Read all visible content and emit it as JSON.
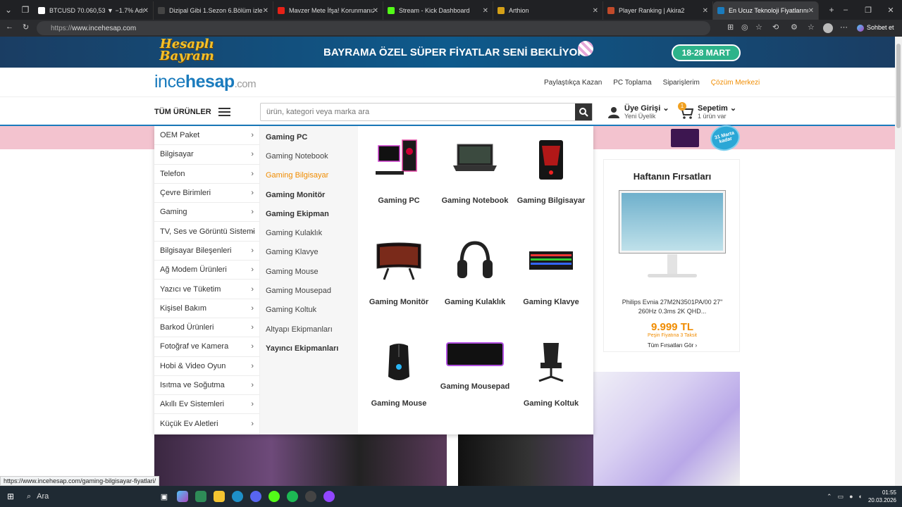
{
  "browser": {
    "tabs": [
      {
        "title": "BTCUSD 70.060,53 ▼ −1.7% Adsı",
        "color": "#ffffff"
      },
      {
        "title": "Dizipal Gibi 1.Sezon 6.Bölüm izle",
        "color": "#444444"
      },
      {
        "title": "Mavzer Mete İfşa! Korunmanız La",
        "color": "#e62117"
      },
      {
        "title": "Stream - Kick Dashboard",
        "color": "#53fc18"
      },
      {
        "title": "Arthion",
        "color": "#d4a017"
      },
      {
        "title": "Player Ranking | Akira2",
        "color": "#c14a2a"
      },
      {
        "title": "En Ucuz Teknoloji Fiyatlarını araya",
        "color": "#1a7bbd"
      }
    ],
    "url_protocol": "https://",
    "url_host": "www.incehesap.com",
    "copilot_label": "Sohbet et",
    "status_url": "https://www.incehesap.com/gaming-bilgisayar-fiyatlari/"
  },
  "banner": {
    "logo_text_1": "Hesaplı",
    "logo_text_2": "Bayram",
    "text": "BAYRAMA ÖZEL SÜPER FİYATLAR SENİ BEKLİYOR!",
    "date": "18-28 MART",
    "promo_text": "31 Marta kadar"
  },
  "header": {
    "logo_ince": "ince",
    "logo_hesap": "hesap",
    "logo_com": ".com",
    "links": [
      "Paylaştıkça Kazan",
      "PC Toplama",
      "Siparişlerim",
      "Çözüm Merkezi"
    ]
  },
  "nav": {
    "all_products": "TÜM ÜRÜNLER",
    "search_placeholder": "ürün, kategori veya marka ara",
    "user_title": "Üye Girişi",
    "user_sub": "Yeni Üyelik",
    "cart_title": "Sepetim",
    "cart_sub": "1 ürün var",
    "cart_count": "1"
  },
  "menu": {
    "categories": [
      "OEM Paket",
      "Bilgisayar",
      "Telefon",
      "Çevre Birimleri",
      "Gaming",
      "TV, Ses ve Görüntü Sistemi",
      "Bilgisayar Bileşenleri",
      "Ağ Modem Ürünleri",
      "Yazıcı ve Tüketim",
      "Kişisel Bakım",
      "Barkod Ürünleri",
      "Fotoğraf ve Kamera",
      "Hobi & Video Oyun",
      "Isıtma ve Soğutma",
      "Akıllı Ev Sistemleri",
      "Küçük Ev Aletleri"
    ],
    "subcategories": [
      {
        "label": "Gaming PC",
        "bold": true
      },
      {
        "label": "Gaming Notebook",
        "bold": false
      },
      {
        "label": "Gaming Bilgisayar",
        "bold": false,
        "hover": true
      },
      {
        "label": "Gaming Monitör",
        "bold": true
      },
      {
        "label": "Gaming Ekipman",
        "bold": true
      },
      {
        "label": "Gaming Kulaklık",
        "bold": false
      },
      {
        "label": "Gaming Klavye",
        "bold": false
      },
      {
        "label": "Gaming Mouse",
        "bold": false
      },
      {
        "label": "Gaming Mousepad",
        "bold": false
      },
      {
        "label": "Gaming Koltuk",
        "bold": false
      },
      {
        "label": "Altyapı Ekipmanları",
        "bold": false
      },
      {
        "label": "Yayıncı Ekipmanları",
        "bold": true
      }
    ],
    "grid": [
      {
        "label": "Gaming PC",
        "icon": "gaming-pc"
      },
      {
        "label": "Gaming Notebook",
        "icon": "gaming-notebook"
      },
      {
        "label": "Gaming Bilgisayar",
        "icon": "gaming-computer"
      },
      {
        "label": "Gaming Monitör",
        "icon": "gaming-monitor"
      },
      {
        "label": "Gaming Kulaklık",
        "icon": "gaming-headset"
      },
      {
        "label": "Gaming Klavye",
        "icon": "gaming-keyboard"
      },
      {
        "label": "Gaming Mouse",
        "icon": "gaming-mouse"
      },
      {
        "label": "Gaming Mousepad",
        "icon": "gaming-mousepad"
      },
      {
        "label": "Gaming Koltuk",
        "icon": "gaming-chair"
      }
    ]
  },
  "deals": {
    "title": "Haftanın Fırsatları",
    "product_name": "Philips Evnia 27M2N3501PA/00 27\" 260Hz 0.3ms 2K QHD...",
    "price": "9.999 TL",
    "installment": "Peşin Fiyatına 3 Taksit",
    "all_link": "Tüm Fırsatları Gör ›"
  },
  "taskbar": {
    "search_label": "Ara",
    "time": "01:55",
    "date": "20.03.2026"
  }
}
